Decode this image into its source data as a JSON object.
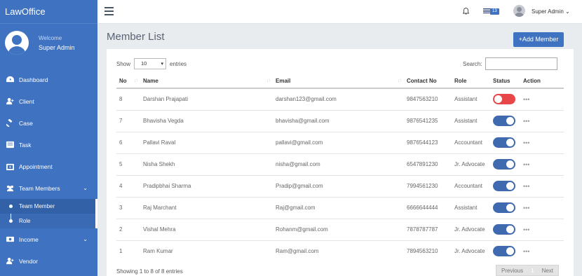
{
  "app": {
    "brand": "LawOffice"
  },
  "profile": {
    "welcome": "Welcome",
    "name": "Super Admin"
  },
  "sidebar": {
    "items": [
      {
        "label": "Dashboard",
        "icon": "dashboard-icon"
      },
      {
        "label": "Client",
        "icon": "user-plus-icon"
      },
      {
        "label": "Case",
        "icon": "gavel-icon"
      },
      {
        "label": "Task",
        "icon": "task-icon"
      },
      {
        "label": "Appointment",
        "icon": "calendar-icon"
      },
      {
        "label": "Team Members",
        "icon": "users-icon"
      }
    ],
    "submenu": [
      {
        "label": "Team Member"
      },
      {
        "label": "Role"
      }
    ],
    "after": [
      {
        "label": "Income",
        "icon": "money-icon"
      },
      {
        "label": "Vendor",
        "icon": "user-plus-icon"
      }
    ]
  },
  "header": {
    "badge": "13",
    "user": "Super Admin ⌄"
  },
  "page": {
    "title": "Member List",
    "add_button": "+Add Member",
    "show_label": "Show",
    "entries_value": "10",
    "entries_label": "entries",
    "search_label": "Search:",
    "info": "Showing 1 to 8 of 8 entries",
    "prev": "Previous",
    "page_num": "1",
    "next": "Next"
  },
  "table": {
    "headers": [
      "No",
      "Name",
      "Email",
      "Contact No",
      "Role",
      "Status",
      "Action"
    ],
    "rows": [
      {
        "no": "8",
        "name": "Darshan Prajapati",
        "email": "darshan123@gmail.com",
        "contact": "9847563210",
        "role": "Assistant",
        "status": "off"
      },
      {
        "no": "7",
        "name": "Bhavisha Vegda",
        "email": "bhavisha@gmail.com",
        "contact": "9876541235",
        "role": "Assistant",
        "status": "on"
      },
      {
        "no": "6",
        "name": "Pallavi Raval",
        "email": "pallavi@gmail.com",
        "contact": "9876544123",
        "role": "Accountant",
        "status": "on"
      },
      {
        "no": "5",
        "name": "Nisha Shekh",
        "email": "nisha@gmail.com",
        "contact": "6547891230",
        "role": "Jr. Advocate",
        "status": "on"
      },
      {
        "no": "4",
        "name": "Pradipbhai Sharma",
        "email": "Pradip@gmail.com",
        "contact": "7994561230",
        "role": "Accountant",
        "status": "on"
      },
      {
        "no": "3",
        "name": "Raj Marchant",
        "email": "Raj@gmail.com",
        "contact": "6666644444",
        "role": "Assistant",
        "status": "on"
      },
      {
        "no": "2",
        "name": "Vishal Mehra",
        "email": "Rohanm@gmail.com",
        "contact": "7878787787",
        "role": "Jr. Advocate",
        "status": "on"
      },
      {
        "no": "1",
        "name": "Ram Kumar",
        "email": "Ram@gmail.com",
        "contact": "7894563210",
        "role": "Jr. Advocate",
        "status": "on"
      }
    ]
  },
  "colors": {
    "primary": "#3f73c1",
    "toggle_on": "#3f6ab0",
    "toggle_off": "#e8474a"
  }
}
